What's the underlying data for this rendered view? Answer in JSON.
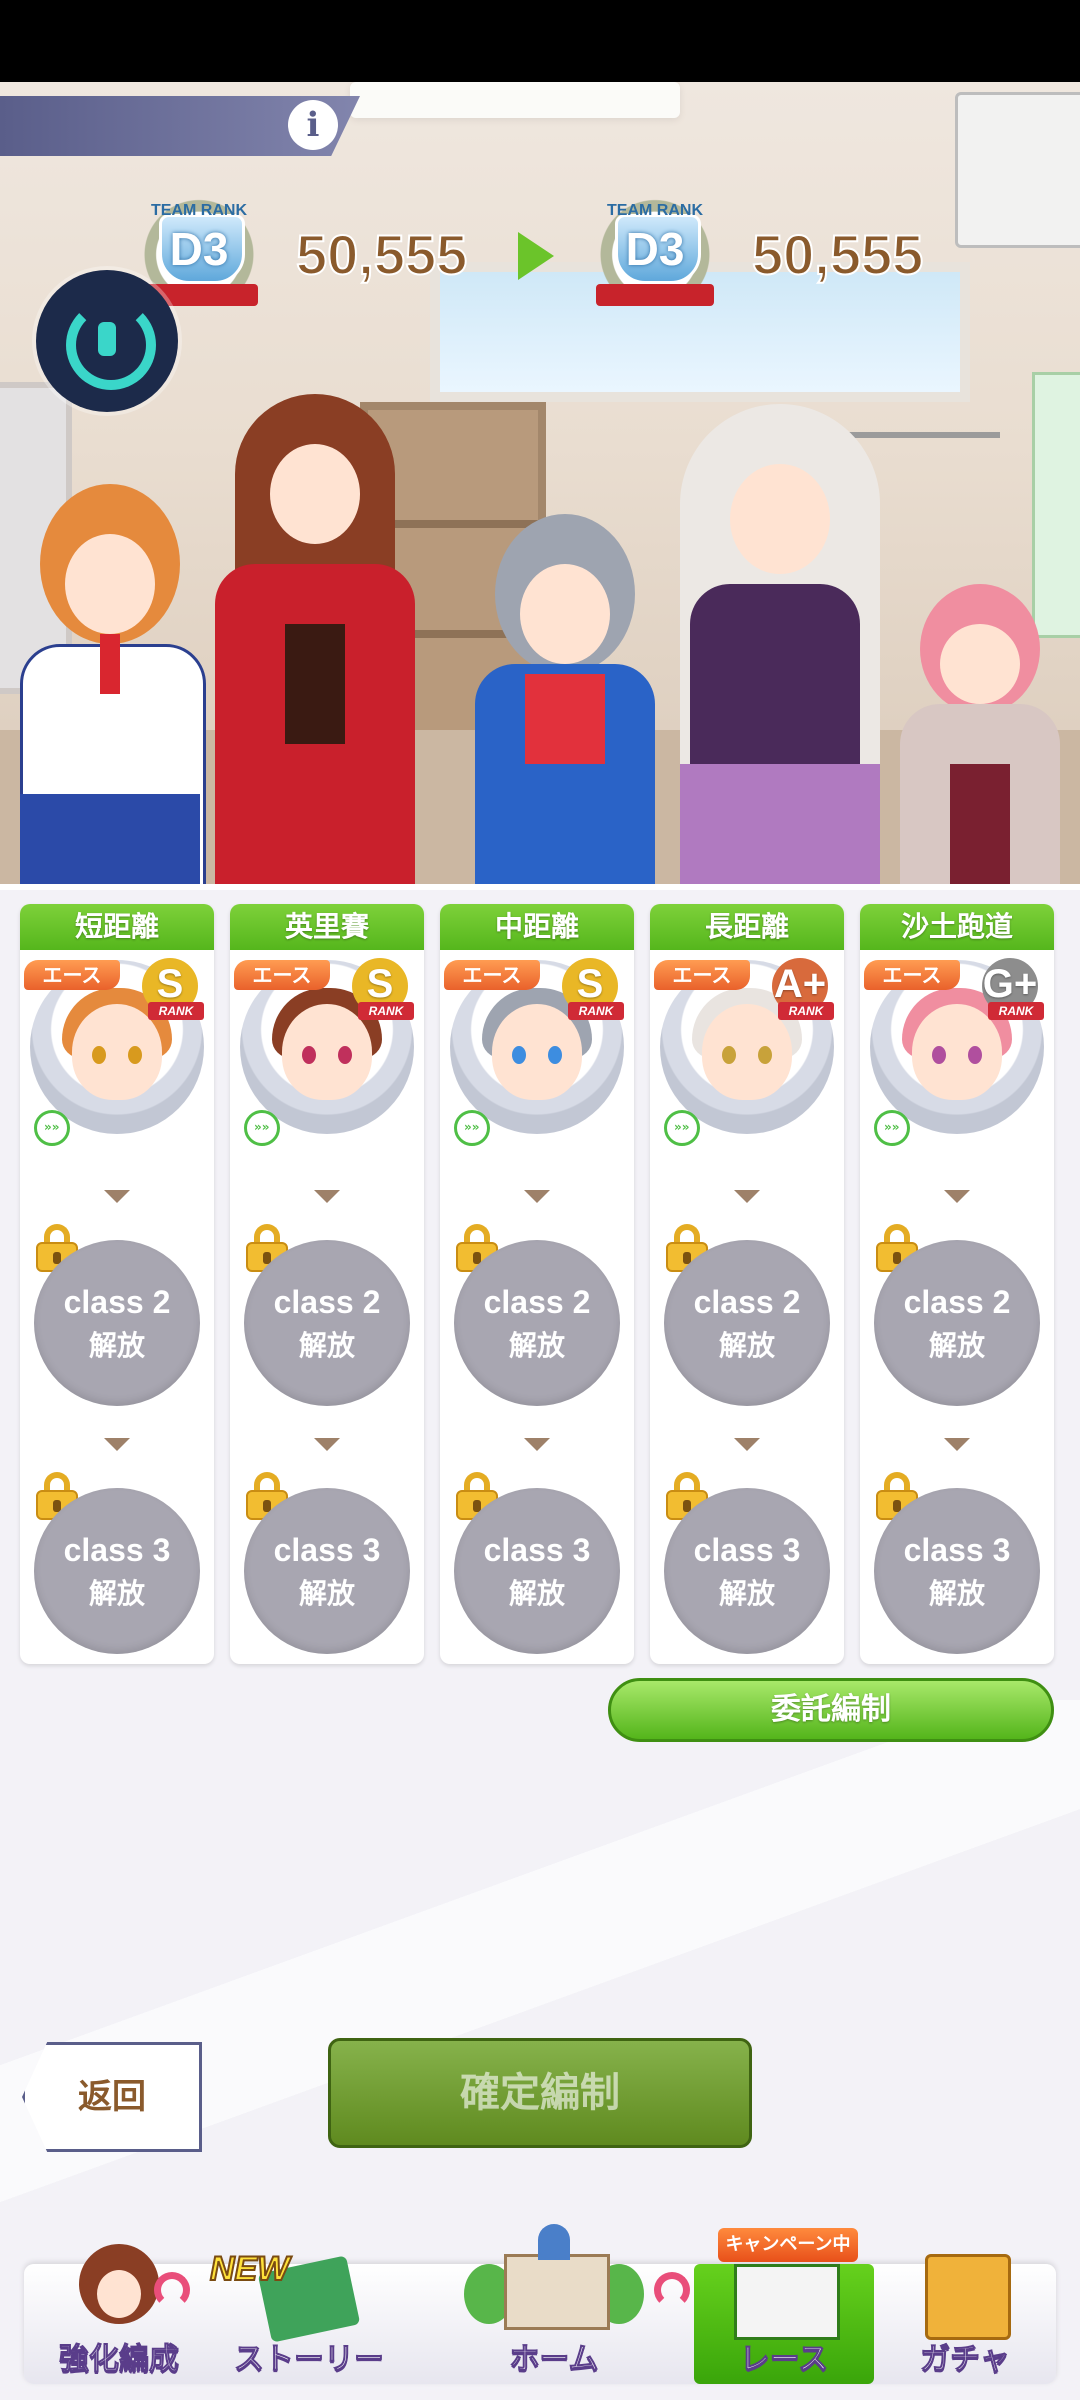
{
  "team_rank": {
    "label": "TEAM RANK",
    "current_code": "D3",
    "current_score": "50,555",
    "next_code": "D3",
    "next_score": "50,555"
  },
  "info_button": "i",
  "columns": [
    {
      "category": "短距離",
      "ace_label": "エース",
      "rank": "S",
      "rank_word": "RANK",
      "class2_line1": "class 2",
      "class2_line2": "解放",
      "class3_line1": "class 3",
      "class3_line2": "解放",
      "hair": "#e58a3d",
      "eye": "#d89a1e",
      "medal": "#e9b726"
    },
    {
      "category": "英里賽",
      "ace_label": "エース",
      "rank": "S",
      "rank_word": "RANK",
      "class2_line1": "class 2",
      "class2_line2": "解放",
      "class3_line1": "class 3",
      "class3_line2": "解放",
      "hair": "#8a3e24",
      "eye": "#c0305c",
      "medal": "#e9b726"
    },
    {
      "category": "中距離",
      "ace_label": "エース",
      "rank": "S",
      "rank_word": "RANK",
      "class2_line1": "class 2",
      "class2_line2": "解放",
      "class3_line1": "class 3",
      "class3_line2": "解放",
      "hair": "#9ea4b0",
      "eye": "#3d8de0",
      "medal": "#e9b726"
    },
    {
      "category": "長距離",
      "ace_label": "エース",
      "rank": "A+",
      "rank_word": "RANK",
      "class2_line1": "class 2",
      "class2_line2": "解放",
      "class3_line1": "class 3",
      "class3_line2": "解放",
      "hair": "#e9e4e0",
      "eye": "#c8a23a",
      "medal": "#d86a3c"
    },
    {
      "category": "沙土跑道",
      "ace_label": "エース",
      "rank": "G+",
      "rank_word": "RANK",
      "class2_line1": "class 2",
      "class2_line2": "解放",
      "class3_line1": "class 3",
      "class3_line2": "解放",
      "hair": "#f08ea0",
      "eye": "#b04f9e",
      "medal": "#8d8d8d"
    }
  ],
  "delegate_button": "委託編制",
  "back_button": "返回",
  "confirm_button": "確定編制",
  "campaign_badge": "キャンペーン中",
  "new_badge": "NEW",
  "nav": [
    {
      "label": "強化編成"
    },
    {
      "label": "ストーリー"
    },
    {
      "label": "ホーム"
    },
    {
      "label": "レース"
    },
    {
      "label": "ガチャ"
    }
  ],
  "colors": {
    "header_green": "#62c024",
    "class_gray": "#a8a6b1",
    "accent_brown": "#8a5a2c"
  }
}
